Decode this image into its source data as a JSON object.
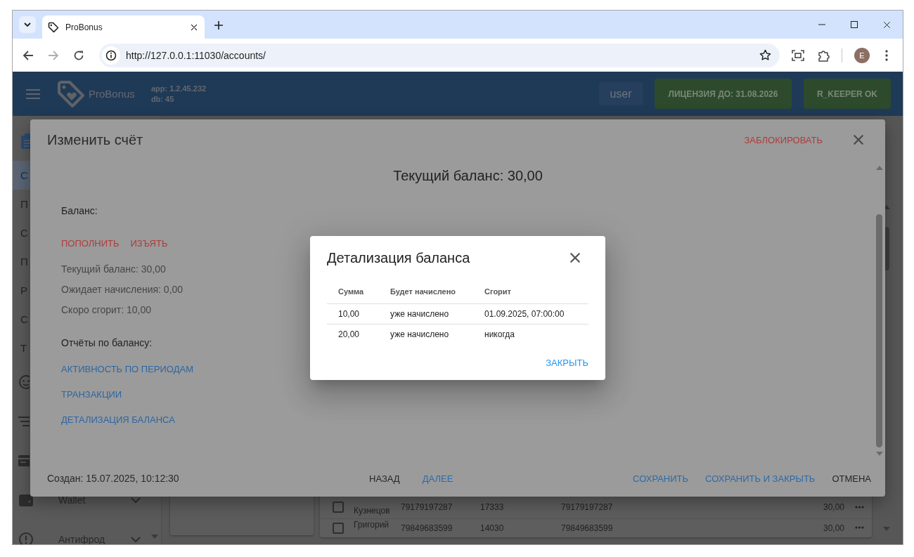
{
  "browser": {
    "tab": {
      "title": "ProBonus",
      "selected": true
    },
    "url": "http://127.0.0.1:11030/accounts/",
    "forward_disabled": true,
    "profile_initial": "E"
  },
  "header": {
    "brand": "ProBonus",
    "version_lines": [
      "app: 1.2.45.232",
      "db: 45"
    ],
    "user": "user",
    "status_buttons": [
      "ЛИЦЕНЗИЯ ДО: 31.08.2026",
      "R_KEEPER OK"
    ]
  },
  "sidebar": {
    "items": [
      {
        "kind": "section"
      },
      {
        "kind": "page",
        "label": "С",
        "selected": true
      },
      {
        "kind": "page",
        "label": "П",
        "selected": false
      },
      {
        "kind": "page",
        "label": "С",
        "selected": false
      },
      {
        "kind": "page",
        "label": "П",
        "selected": false
      },
      {
        "kind": "page",
        "label": "Р",
        "selected": false
      },
      {
        "kind": "page",
        "label": "С",
        "selected": false
      },
      {
        "kind": "page",
        "label": "Т",
        "selected": false
      },
      {
        "kind": "section"
      },
      {
        "kind": "section"
      },
      {
        "kind": "section"
      },
      {
        "kind": "section",
        "label": "Wallet",
        "expanded": false
      },
      {
        "kind": "section",
        "label": "Антифрод",
        "expanded": false
      }
    ]
  },
  "table": {
    "rows": [
      {
        "checked": false,
        "cells": [
          "Кузнецов",
          "79179197287",
          "17333",
          "79179197287",
          "30,00"
        ]
      },
      {
        "checked": false,
        "cells": [
          "Григорий",
          "79849683599",
          "14030",
          "79849683599",
          "30,00"
        ]
      }
    ]
  },
  "edit_dialog": {
    "title": "Изменить счёт",
    "block_action": {
      "label": "ЗАБЛОКИРОВАТЬ",
      "kind": "danger"
    },
    "current_balance": "Текущий баланс: 30,00",
    "balance_label": "Баланс:",
    "balance_actions": [
      {
        "label": "ПОПОЛНИТЬ",
        "kind": "danger"
      },
      {
        "label": "ИЗЪЯТЬ",
        "kind": "danger"
      }
    ],
    "balance_lines": [
      "Текущий баланс: 30,00",
      "Ожидает начисления: 0,00",
      "Скоро сгорит: 10,00"
    ],
    "reports_label": "Отчёты по балансу:",
    "report_links": [
      "АКТИВНОСТЬ ПО ПЕРИОДАМ",
      "ТРАНЗАКЦИИ",
      "ДЕТАЛИЗАЦИЯ БАЛАНСА"
    ],
    "created": "Создан: 15.07.2025, 10:12:30",
    "nav_buttons": [
      {
        "label": "НАЗАД",
        "kind": "plain"
      },
      {
        "label": "ДАЛЕЕ",
        "kind": "primary"
      }
    ],
    "footer_buttons": [
      {
        "label": "СОХРАНИТЬ",
        "kind": "primary"
      },
      {
        "label": "СОХРАНИТЬ И ЗАКРЫТЬ",
        "kind": "primary"
      },
      {
        "label": "ОТМЕНА",
        "kind": "plain"
      }
    ]
  },
  "detail_dialog": {
    "title": "Детализация баланса",
    "columns": [
      "Сумма",
      "Будет начислено",
      "Сгорит"
    ],
    "rows": [
      [
        "10,00",
        "уже начислено",
        "01.09.2025, 07:00:00"
      ],
      [
        "20,00",
        "уже начислено",
        "никогда"
      ]
    ],
    "close_button": "ЗАКРЫТЬ"
  }
}
